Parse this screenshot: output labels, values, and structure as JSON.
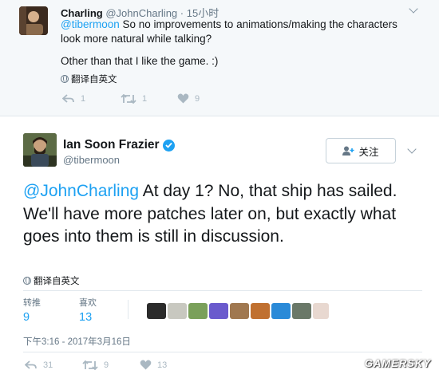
{
  "reply": {
    "name": "Charling",
    "handle": "@JohnCharling",
    "separator": "·",
    "time": "15小时",
    "mention": "@tibermoon",
    "text": " So no improvements to animations/making the characters look more natural while talking?",
    "text2": "Other than that I like the game. :)",
    "translate": "翻译自英文",
    "reply_count": "1",
    "retweet_count": "1",
    "like_count": "9"
  },
  "tweet": {
    "name": "Ian Soon Frazier",
    "handle": "@tibermoon",
    "follow_label": "关注",
    "mention": "@JohnCharling",
    "text": " At day 1? No, that ship has sailed. We'll have more patches later on, but exactly what goes into them is still in discussion.",
    "translate": "翻译自英文",
    "retweets_label": "转推",
    "retweets_value": "9",
    "likes_label": "喜欢",
    "likes_value": "13",
    "timestamp": "下午3:16 - 2017年3月16日",
    "reply_count": "31",
    "retweet_count": "9",
    "like_count": "13"
  },
  "watermark": "GAMERSKY",
  "colors": {
    "accent": "#1da1f2",
    "muted": "#657786",
    "reply_bg": "#f5f8fa",
    "border": "#e1e8ed"
  },
  "icons": [
    "caret-down-icon",
    "globe-icon",
    "reply-icon",
    "retweet-icon",
    "heart-icon",
    "follow-user-icon",
    "verified-icon"
  ]
}
